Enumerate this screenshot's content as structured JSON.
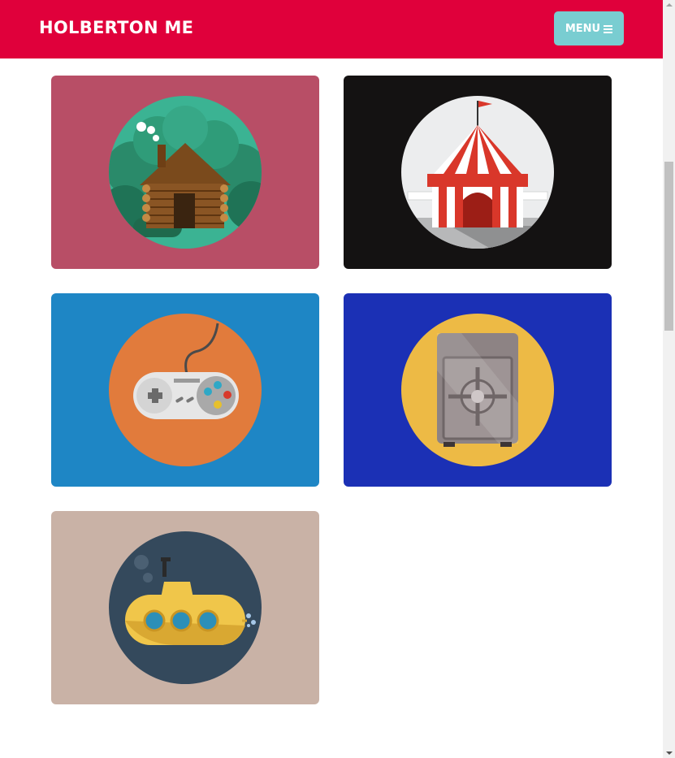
{
  "navbar": {
    "brand": "HOLBERTON ME",
    "menu_label": "MENU",
    "background": "#e0003b",
    "menu_background": "#79cdd1"
  },
  "portfolio": {
    "items": [
      {
        "icon": "log-cabin-icon",
        "background": "#b84e66"
      },
      {
        "icon": "circus-tent-icon",
        "background": "#141212"
      },
      {
        "icon": "game-controller-icon",
        "background": "#1e86c5"
      },
      {
        "icon": "safe-icon",
        "background": "#1b30b5"
      },
      {
        "icon": "submarine-icon",
        "background": "#c9b2a6"
      }
    ]
  }
}
